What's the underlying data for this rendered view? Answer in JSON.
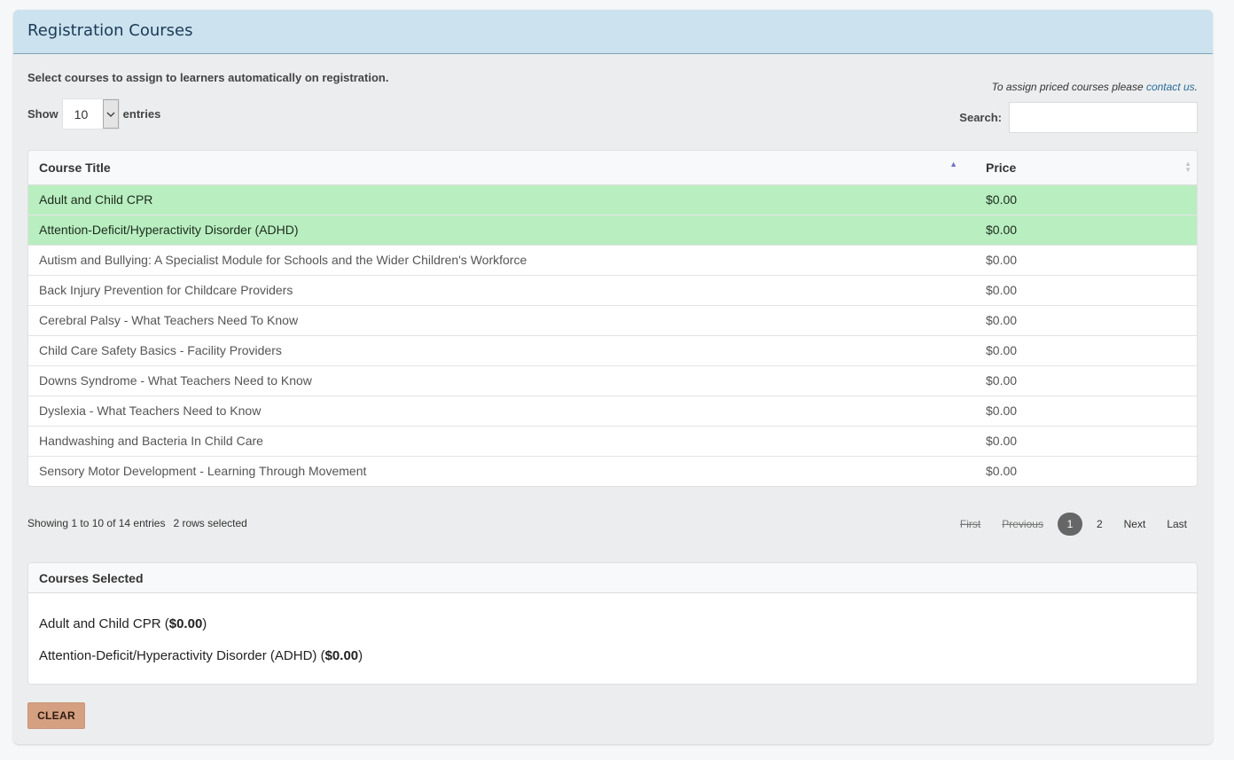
{
  "header": {
    "title": "Registration Courses"
  },
  "intro_text": "Select courses to assign to learners automatically on registration.",
  "priced_note": {
    "text": "To assign priced courses please ",
    "link": "contact us",
    "suffix": "."
  },
  "length": {
    "show_label": "Show",
    "value": "10",
    "entries_label": "entries"
  },
  "search": {
    "label": "Search:",
    "value": ""
  },
  "table": {
    "columns": [
      "Course Title",
      "Price"
    ],
    "rows": [
      {
        "title": "Adult and Child CPR",
        "price": "$0.00",
        "selected": true
      },
      {
        "title": "Attention-Deficit/Hyperactivity Disorder (ADHD)",
        "price": "$0.00",
        "selected": true
      },
      {
        "title": "Autism and Bullying: A Specialist Module for Schools and the Wider Children's Workforce",
        "price": "$0.00",
        "selected": false
      },
      {
        "title": "Back Injury Prevention for Childcare Providers",
        "price": "$0.00",
        "selected": false
      },
      {
        "title": "Cerebral Palsy - What Teachers Need To Know",
        "price": "$0.00",
        "selected": false
      },
      {
        "title": "Child Care Safety Basics - Facility Providers",
        "price": "$0.00",
        "selected": false
      },
      {
        "title": "Downs Syndrome - What Teachers Need to Know",
        "price": "$0.00",
        "selected": false
      },
      {
        "title": "Dyslexia - What Teachers Need to Know",
        "price": "$0.00",
        "selected": false
      },
      {
        "title": "Handwashing and Bacteria In Child Care",
        "price": "$0.00",
        "selected": false
      },
      {
        "title": "Sensory Motor Development - Learning Through Movement",
        "price": "$0.00",
        "selected": false
      }
    ]
  },
  "info": {
    "showing": "Showing 1 to 10 of 14 entries",
    "selected": "2 rows selected"
  },
  "pagination": {
    "first": "First",
    "previous": "Previous",
    "pages": [
      "1",
      "2"
    ],
    "current": "1",
    "next": "Next",
    "last": "Last"
  },
  "courses_selected": {
    "title": "Courses Selected",
    "items": [
      {
        "title": "Adult and Child CPR",
        "price": "$0.00"
      },
      {
        "title": "Attention-Deficit/Hyperactivity Disorder (ADHD)",
        "price": "$0.00"
      }
    ]
  },
  "clear_button": "CLEAR",
  "colors": {
    "header_bg": "#cce2ee",
    "selected_row": "#b9eec0",
    "clear_button": "#d4a081",
    "link": "#2a6f9b"
  }
}
